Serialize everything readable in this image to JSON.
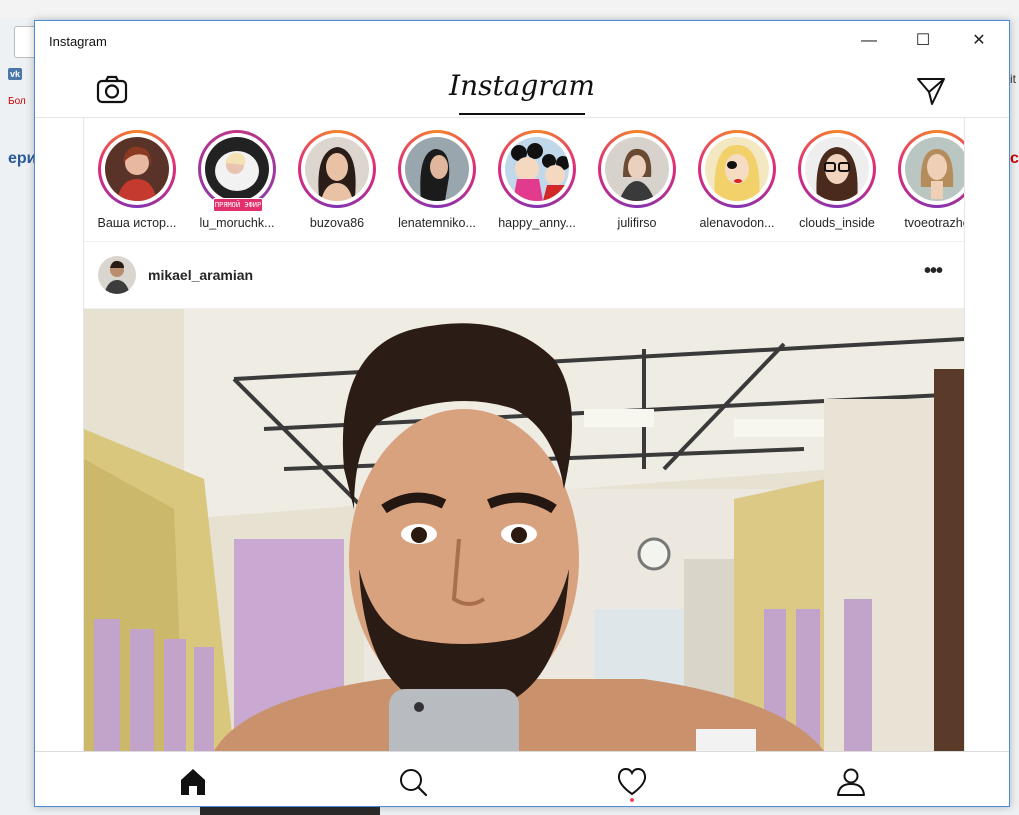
{
  "window": {
    "title": "Instagram",
    "controls": {
      "minimize": "—",
      "maximize": "☐",
      "close": "✕"
    }
  },
  "header": {
    "logo_text": "Instagram",
    "icons": [
      "camera-icon",
      "direct-message-icon"
    ]
  },
  "stories": [
    {
      "label": "Ваша истор...",
      "live": false
    },
    {
      "label": "lu_moruchk...",
      "live": true,
      "live_badge": "ПРЯМОЙ ЭФИР"
    },
    {
      "label": "buzova86",
      "live": false
    },
    {
      "label": "lenatemniko...",
      "live": false
    },
    {
      "label": "happy_anny...",
      "live": false
    },
    {
      "label": "julifirso",
      "live": false
    },
    {
      "label": "alenavodon...",
      "live": false
    },
    {
      "label": "clouds_inside",
      "live": false
    },
    {
      "label": "tvoeotrazhe",
      "live": false
    }
  ],
  "post": {
    "username": "mikael_aramian",
    "more_icon": "•••"
  },
  "bottom_nav": {
    "items": [
      "home-icon",
      "search-icon",
      "activity-heart-icon",
      "profile-icon"
    ],
    "active": "home-icon",
    "notification_dot_on": "activity-heart-icon"
  },
  "colors": {
    "story_ring_start": "#f58529",
    "story_ring_mid": "#dd2a7b",
    "story_ring_end": "#8134af",
    "live_badge": "#e1306c",
    "notification_dot": "#ed4956",
    "window_border": "#4a8ad8"
  },
  "background_fragments": {
    "vk_icon": "vk",
    "left_text_1": "Бол",
    "left_text_2": "ери",
    "right_text_1": "it",
    "right_text_2": "c"
  }
}
